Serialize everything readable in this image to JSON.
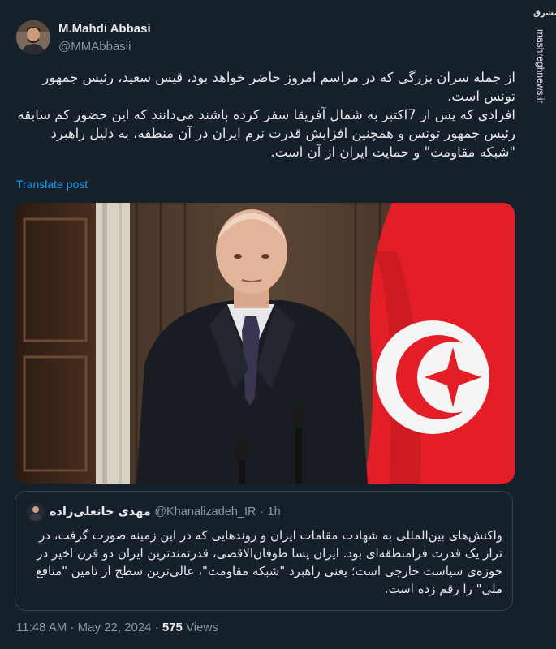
{
  "author": {
    "name": "M.Mahdi Abbasi",
    "handle": "@MMAbbasii"
  },
  "tweet": {
    "paragraph1": "از جمله سران بزرگی که در مراسم امروز حاضر خواهد بود، قیس سعید، رئیس جمهور تونس است.",
    "paragraph2": "افرادی که پس از 7اکتبر به شمال آفریقا سفر کرده باشند می‌دانند که این حضور کم سابقه رئیس جمهور تونس و همچنین افزایش قدرت نرم ایران در آن منطقه، به دلیل راهبرد \"شبکه مقاومت\" و حمایت ایران از آن است.",
    "translate_label": "Translate post"
  },
  "quoted_tweet": {
    "name": "مهدی خانعلی‌زاده",
    "handle": "@Khanalizadeh_IR",
    "separator": "·",
    "time": "1h",
    "text": "واکنش‌های بین‌المللی به شهادت مقامات ایران و روندهایی که در این زمینه صورت گرفت، در تراز یک قدرت فرامنطقه‌ای بود. ایران پسا طوفان‌الاقصی، قدرتمندترین ایران دو قرن اخیر در حوزه‌ی سیاست خارجی است؛ یعنی راهبرد \"شبکه مقاومت\"، عالی‌ترین سطح از تامین \"منافع ملی\" را رقم زده است."
  },
  "footer": {
    "time": "11:48 AM",
    "separator1": "·",
    "date": "May 22, 2024",
    "separator2": "·",
    "views_count": "575",
    "views_label": "Views"
  },
  "watermark": {
    "logo": "مشرق",
    "site": "mashreghnews.ir"
  },
  "colors": {
    "background": "#15202b",
    "text": "#e7e9ea",
    "secondary": "#8b98a5",
    "link": "#1d9bf0",
    "border": "#38444d",
    "flag_red": "#e41e26"
  },
  "icons": {
    "quoted_avatar": "avatar-icon"
  }
}
